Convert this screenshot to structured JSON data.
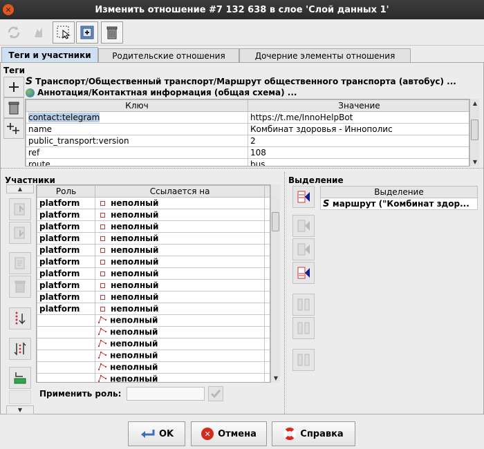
{
  "window": {
    "title": "Изменить отношение #7 132 638 в слое 'Слой данных 1'"
  },
  "toolbar": {
    "icons": [
      "refresh-icon",
      "zoom-to-icon",
      "select-icon",
      "download-members-icon",
      "delete-icon"
    ]
  },
  "tabs": [
    "Теги и участники",
    "Родительские отношения",
    "Дочерние элементы отношения"
  ],
  "tags": {
    "section_label": "Теги",
    "presets": [
      "Транспорт/Общественный транспорт/Маршрут общественного транспорта (автобус) ...",
      "Аннотация/Контактная информация (общая схема) ..."
    ],
    "columns": [
      "Ключ",
      "Значение"
    ],
    "rows": [
      {
        "key": "contact:telegram",
        "value": "https://t.me/InnoHelpBot"
      },
      {
        "key": "name",
        "value": "Комбинат здоровья - Иннополис"
      },
      {
        "key": "public_transport:version",
        "value": "2"
      },
      {
        "key": "ref",
        "value": "108"
      },
      {
        "key": "route",
        "value": "bus"
      }
    ]
  },
  "members": {
    "section_label": "Участники",
    "columns": [
      "Роль",
      "Ссылается на"
    ],
    "rows": [
      {
        "role": "platform",
        "ref": "неполный",
        "type": "node"
      },
      {
        "role": "platform",
        "ref": "неполный",
        "type": "node"
      },
      {
        "role": "platform",
        "ref": "неполный",
        "type": "node"
      },
      {
        "role": "platform",
        "ref": "неполный",
        "type": "node"
      },
      {
        "role": "platform",
        "ref": "неполный",
        "type": "node"
      },
      {
        "role": "platform",
        "ref": "неполный",
        "type": "node"
      },
      {
        "role": "platform",
        "ref": "неполный",
        "type": "node"
      },
      {
        "role": "platform",
        "ref": "неполный",
        "type": "node"
      },
      {
        "role": "platform",
        "ref": "неполный",
        "type": "node"
      },
      {
        "role": "platform",
        "ref": "неполный",
        "type": "node"
      },
      {
        "role": "",
        "ref": "неполный",
        "type": "way"
      },
      {
        "role": "",
        "ref": "неполный",
        "type": "way"
      },
      {
        "role": "",
        "ref": "неполный",
        "type": "way"
      },
      {
        "role": "",
        "ref": "неполный",
        "type": "way"
      },
      {
        "role": "",
        "ref": "неполный",
        "type": "way"
      },
      {
        "role": "",
        "ref": "неполный",
        "type": "way"
      }
    ],
    "apply_role_label": "Применить роль:",
    "apply_role_value": ""
  },
  "selection": {
    "section_label": "Выделение",
    "column": "Выделение",
    "rows": [
      "маршрут (\"Комбинат здор..."
    ]
  },
  "buttons": {
    "ok": "OK",
    "cancel": "Отмена",
    "help": "Справка"
  },
  "colors": {
    "accent": "#cfe0f2",
    "selected_row": "#b8cfe5",
    "cancel_red": "#d62a1e"
  }
}
